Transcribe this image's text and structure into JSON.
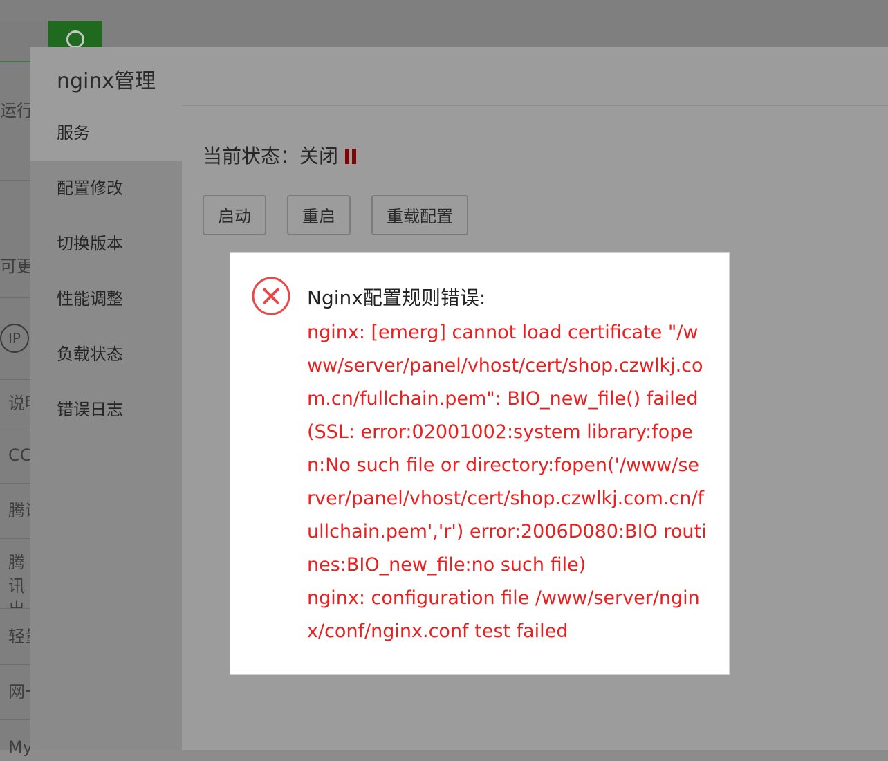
{
  "background": {
    "rows": [
      "运行环",
      "可更",
      "说明",
      "CC",
      "腾讯",
      "腾讯出海",
      "轻量",
      "网一",
      "My"
    ],
    "ip_badge": "IP"
  },
  "panel": {
    "title": "nginx管理",
    "nav": [
      {
        "label": "服务",
        "active": true
      },
      {
        "label": "配置修改"
      },
      {
        "label": "切换版本"
      },
      {
        "label": "性能调整"
      },
      {
        "label": "负载状态"
      },
      {
        "label": "错误日志"
      }
    ],
    "status_label": "当前状态：",
    "status_value": "关闭",
    "status_icon": "pause-icon",
    "buttons": {
      "start": "启动",
      "restart": "重启",
      "reload": "重载配置"
    }
  },
  "dialog": {
    "icon": "error-circle-x-icon",
    "title": "Nginx配置规则错误:",
    "lines": [
      "nginx: [emerg] cannot load certificate \"/www/server/panel/vhost/cert/shop.czwlkj.com.cn/fullchain.pem\": BIO_new_file() failed (SSL: error:02001002:system library:fopen:No such file or directory:fopen('/www/server/panel/vhost/cert/shop.czwlkj.com.cn/fullchain.pem','r') error:2006D080:BIO routines:BIO_new_file:no such file)",
      "nginx: configuration file /www/server/nginx/conf/nginx.conf test failed"
    ],
    "colors": {
      "error_text": "#ea2020",
      "icon": "#e84848"
    }
  }
}
